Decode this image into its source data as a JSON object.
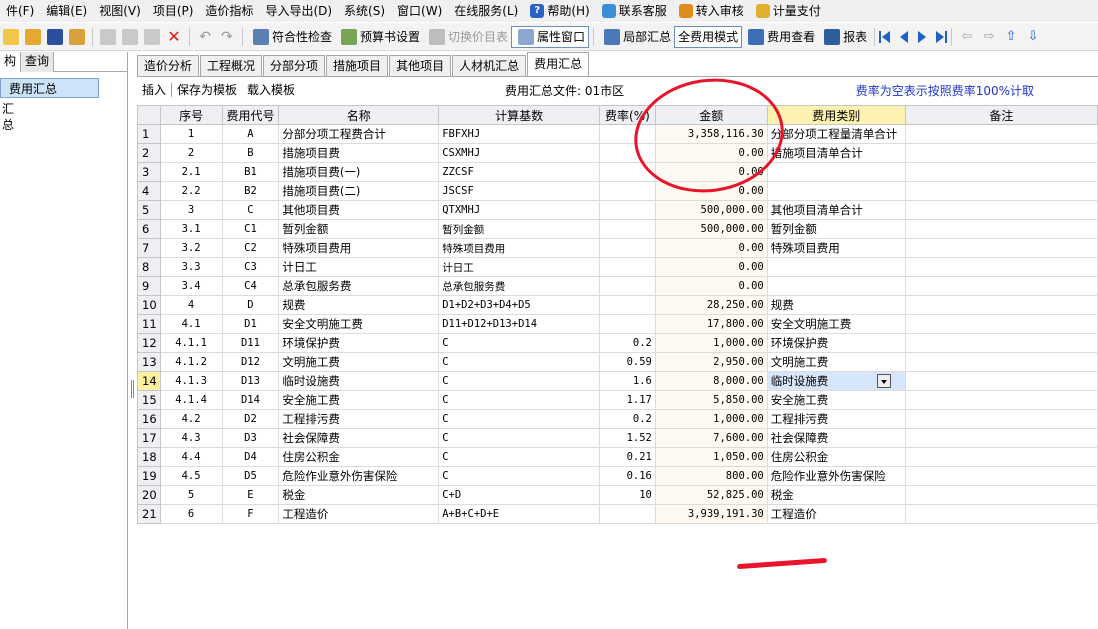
{
  "menu": [
    {
      "label": "件(F)"
    },
    {
      "label": "编辑(E)"
    },
    {
      "label": "视图(V)"
    },
    {
      "label": "项目(P)"
    },
    {
      "label": "造价指标"
    },
    {
      "label": "导入导出(D)"
    },
    {
      "label": "系统(S)"
    },
    {
      "label": "窗口(W)"
    },
    {
      "label": "在线服务(L)"
    }
  ],
  "menu_extra": {
    "help": "帮助(H)",
    "support": "联系客服",
    "audit": "转入审核",
    "pay": "计量支付"
  },
  "toolbar": {
    "compliance_check": "符合性检查",
    "budget_settings": "预算书设置",
    "switch_price_table": "切换价目表",
    "attributes_window": "属性窗口",
    "local_summary": "局部汇总",
    "full_fee_mode": "全费用模式",
    "fee_view": "费用查看",
    "report": "报表"
  },
  "left_panel": {
    "tab_structure": "构",
    "tab_query": "查询",
    "selected_node": "费用汇总",
    "child_node": "汇总"
  },
  "tabs": [
    {
      "label": "造价分析"
    },
    {
      "label": "工程概况"
    },
    {
      "label": "分部分项"
    },
    {
      "label": "措施项目"
    },
    {
      "label": "其他项目"
    },
    {
      "label": "人材机汇总"
    },
    {
      "label": "费用汇总"
    }
  ],
  "subbar": {
    "insert": "插入",
    "save_template": "保存为模板",
    "load_template": "载入模板",
    "file_label": "费用汇总文件: 01市区",
    "rate_note": "费率为空表示按照费率100%计取"
  },
  "table": {
    "headers": {
      "rn": "",
      "seq": "序号",
      "code": "费用代号",
      "name": "名称",
      "base": "计算基数",
      "rate": "费率(%)",
      "amount": "金额",
      "category": "费用类别",
      "remark": "备注"
    },
    "rows": [
      {
        "rn": "1",
        "seq": "1",
        "code": "A",
        "name": "分部分项工程费合计",
        "base": "FBFXHJ",
        "rate": "",
        "amount": "3,358,116.30",
        "category": "分部分项工程量清单合计",
        "remark": ""
      },
      {
        "rn": "2",
        "seq": "2",
        "code": "B",
        "name": "措施项目费",
        "base": "CSXMHJ",
        "rate": "",
        "amount": "0.00",
        "category": "措施项目清单合计",
        "remark": ""
      },
      {
        "rn": "3",
        "seq": "2.1",
        "code": "B1",
        "name": "措施项目费(一)",
        "base": "ZZCSF",
        "rate": "",
        "amount": "0.00",
        "category": "",
        "remark": ""
      },
      {
        "rn": "4",
        "seq": "2.2",
        "code": "B2",
        "name": "措施项目费(二)",
        "base": "JSCSF",
        "rate": "",
        "amount": "0.00",
        "category": "",
        "remark": ""
      },
      {
        "rn": "5",
        "seq": "3",
        "code": "C",
        "name": "其他项目费",
        "base": "QTXMHJ",
        "rate": "",
        "amount": "500,000.00",
        "category": "其他项目清单合计",
        "remark": ""
      },
      {
        "rn": "6",
        "seq": "3.1",
        "code": "C1",
        "name": "暂列金额",
        "base": "暂列金额",
        "rate": "",
        "amount": "500,000.00",
        "category": "暂列金额",
        "remark": ""
      },
      {
        "rn": "7",
        "seq": "3.2",
        "code": "C2",
        "name": "特殊项目费用",
        "base": "特殊项目费用",
        "rate": "",
        "amount": "0.00",
        "category": "特殊项目费用",
        "remark": ""
      },
      {
        "rn": "8",
        "seq": "3.3",
        "code": "C3",
        "name": "计日工",
        "base": "计日工",
        "rate": "",
        "amount": "0.00",
        "category": "",
        "remark": ""
      },
      {
        "rn": "9",
        "seq": "3.4",
        "code": "C4",
        "name": "总承包服务费",
        "base": "总承包服务费",
        "rate": "",
        "amount": "0.00",
        "category": "",
        "remark": ""
      },
      {
        "rn": "10",
        "seq": "4",
        "code": "D",
        "name": "规费",
        "base": "D1+D2+D3+D4+D5",
        "rate": "",
        "amount": "28,250.00",
        "category": "规费",
        "remark": ""
      },
      {
        "rn": "11",
        "seq": "4.1",
        "code": "D1",
        "name": "安全文明施工费",
        "base": "D11+D12+D13+D14",
        "rate": "",
        "amount": "17,800.00",
        "category": "安全文明施工费",
        "remark": ""
      },
      {
        "rn": "12",
        "seq": "4.1.1",
        "code": "D11",
        "name": "环境保护费",
        "base": "C",
        "rate": "0.2",
        "amount": "1,000.00",
        "category": "环境保护费",
        "remark": ""
      },
      {
        "rn": "13",
        "seq": "4.1.2",
        "code": "D12",
        "name": "文明施工费",
        "base": "C",
        "rate": "0.59",
        "amount": "2,950.00",
        "category": "文明施工费",
        "remark": ""
      },
      {
        "rn": "14",
        "seq": "4.1.3",
        "code": "D13",
        "name": "临时设施费",
        "base": "C",
        "rate": "1.6",
        "amount": "8,000.00",
        "category": "临时设施费",
        "remark": ""
      },
      {
        "rn": "15",
        "seq": "4.1.4",
        "code": "D14",
        "name": "安全施工费",
        "base": "C",
        "rate": "1.17",
        "amount": "5,850.00",
        "category": "安全施工费",
        "remark": ""
      },
      {
        "rn": "16",
        "seq": "4.2",
        "code": "D2",
        "name": "工程排污费",
        "base": "C",
        "rate": "0.2",
        "amount": "1,000.00",
        "category": "工程排污费",
        "remark": ""
      },
      {
        "rn": "17",
        "seq": "4.3",
        "code": "D3",
        "name": "社会保障费",
        "base": "C",
        "rate": "1.52",
        "amount": "7,600.00",
        "category": "社会保障费",
        "remark": ""
      },
      {
        "rn": "18",
        "seq": "4.4",
        "code": "D4",
        "name": "住房公积金",
        "base": "C",
        "rate": "0.21",
        "amount": "1,050.00",
        "category": "住房公积金",
        "remark": ""
      },
      {
        "rn": "19",
        "seq": "4.5",
        "code": "D5",
        "name": "危险作业意外伤害保险",
        "base": "C",
        "rate": "0.16",
        "amount": "800.00",
        "category": "危险作业意外伤害保险",
        "remark": ""
      },
      {
        "rn": "20",
        "seq": "5",
        "code": "E",
        "name": "税金",
        "base": "C+D",
        "rate": "10",
        "amount": "52,825.00",
        "category": "税金",
        "remark": ""
      },
      {
        "rn": "21",
        "seq": "6",
        "code": "F",
        "name": "工程造价",
        "base": "A+B+C+D+E",
        "rate": "",
        "amount": "3,939,191.30",
        "category": "工程造价",
        "remark": ""
      }
    ]
  },
  "colors": {
    "annotation": "#e8142a",
    "selection": "#cde3f7",
    "category_header": "#fdf2b0",
    "note_text": "#1f36c8"
  }
}
